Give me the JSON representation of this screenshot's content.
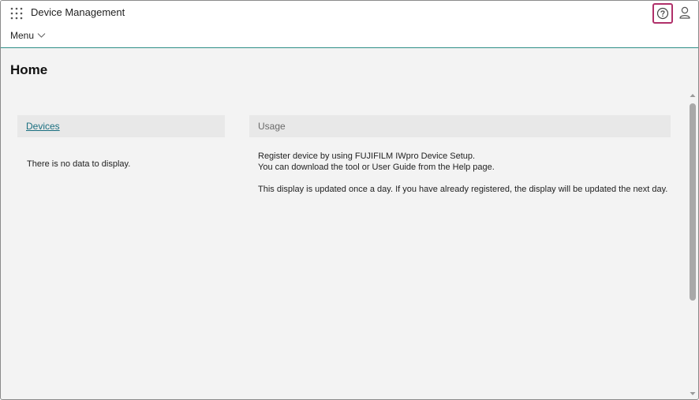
{
  "header": {
    "app_title": "Device Management",
    "menu_label": "Menu",
    "icons": {
      "apps": "apps-grid-icon",
      "help": "help-icon",
      "user": "user-icon",
      "menu_chevron": "chevron-down-icon"
    },
    "accent_color": "#2f8f87",
    "help_highlight_color": "#b0306a"
  },
  "page": {
    "title": "Home"
  },
  "devices_panel": {
    "header_link": "Devices",
    "empty_message": "There is no data to display."
  },
  "usage_panel": {
    "header": "Usage",
    "line1": "Register device by using FUJIFILM IWpro Device Setup.",
    "line2": "You can download the tool or User Guide from the Help page.",
    "line3": "This display is updated once a day. If you have already registered, the display will be updated the next day."
  }
}
